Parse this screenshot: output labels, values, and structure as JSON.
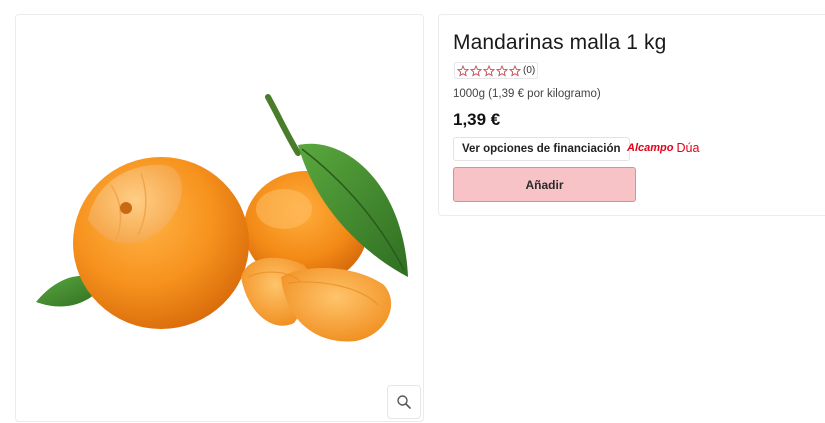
{
  "product": {
    "title": "Mandarinas malla 1 kg",
    "rating_count": "(0)",
    "stars": 5,
    "unit_price": "1000g (1,39 € por kilogramo)",
    "price": "1,39 €"
  },
  "actions": {
    "finance_label": "Ver opciones de financiación",
    "add_label": "Añadir"
  },
  "financing_brand": {
    "brand": "Alcampo",
    "sub": "Dúa"
  },
  "image": {
    "alt": "mandarins-photo",
    "zoom_icon": "magnifier-icon"
  },
  "colors": {
    "accent": "#e2001a",
    "add_button_bg": "#f7c3c6",
    "add_button_border": "#e68a91",
    "orange": "#f6921e",
    "leaf": "#3e8b2f"
  }
}
